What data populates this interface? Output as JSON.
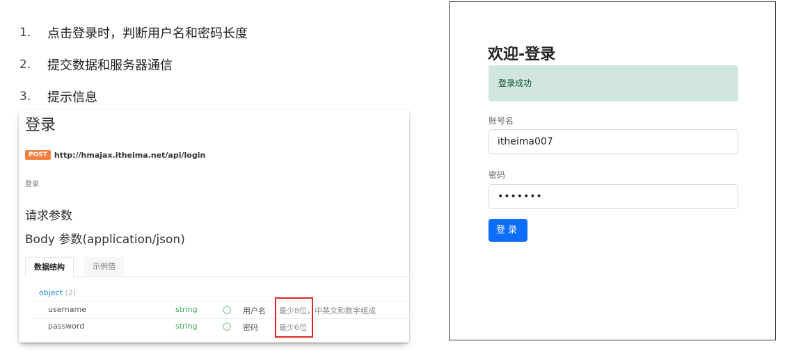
{
  "steps": [
    {
      "num": "1.",
      "text": "点击登录时，判断用户名和密码长度"
    },
    {
      "num": "2.",
      "text": "提交数据和服务器通信"
    },
    {
      "num": "3.",
      "text": "提示信息"
    }
  ],
  "doc": {
    "title": "登录",
    "method": "POST",
    "url": "http://hmajax.itheima.net/api/login",
    "desc": "登录",
    "params_title": "请求参数",
    "body_title": "Body 参数(application/json)",
    "tabs": [
      "数据结构",
      "示例值"
    ],
    "object_label": "object",
    "object_count": "(2)",
    "rows": [
      {
        "name": "username",
        "type": "string",
        "label": "用户名",
        "rule": "最少8位，中英文和数字组成"
      },
      {
        "name": "password",
        "type": "string",
        "label": "密码",
        "rule": "最少6位"
      }
    ]
  },
  "login": {
    "title": "欢迎-登录",
    "alert": "登录成功",
    "username_label": "账号名",
    "username_value": "itheima007",
    "password_label": "密码",
    "password_value": "•••••••",
    "submit_label": "登录"
  },
  "colors": {
    "post_badge": "#f5803e",
    "alert_bg": "#d1e7dd",
    "primary": "#0d6efd",
    "type_green": "#3aa757",
    "highlight_red": "#e02424"
  }
}
